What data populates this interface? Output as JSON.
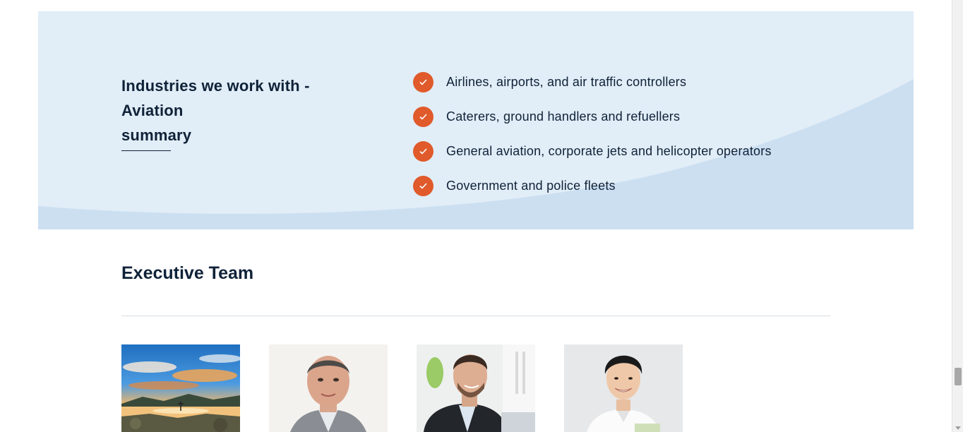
{
  "industries": {
    "title_lines": [
      "Industries we work with -",
      "Aviation",
      "summary"
    ],
    "items": [
      {
        "label": "Airlines, airports, and air traffic controllers",
        "icon": "check-icon"
      },
      {
        "label": "Caterers, ground handlers and refuellers",
        "icon": "check-icon"
      },
      {
        "label": "General aviation, corporate jets and helicopter operators",
        "icon": "check-icon"
      },
      {
        "label": "Government and police fleets",
        "icon": "check-icon"
      }
    ]
  },
  "executive_team": {
    "title": "Executive Team",
    "members": [
      {
        "photo": "landscape-photo"
      },
      {
        "photo": "man-portrait-photo"
      },
      {
        "photo": "businessman-laptop-photo"
      },
      {
        "photo": "smiling-man-photo"
      }
    ]
  },
  "colors": {
    "band_background": "#e1edf7",
    "band_wave": "#cbdff1",
    "accent_orange": "#e05a2b",
    "text_navy": "#0f2238"
  }
}
